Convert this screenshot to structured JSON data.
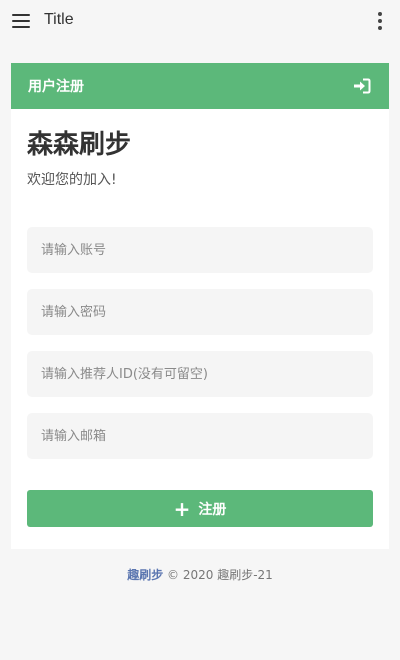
{
  "appbar": {
    "title": "Title",
    "menu_icon": "hamburger-menu-icon",
    "more_icon": "more-vert-icon"
  },
  "card": {
    "header_title": "用户注册",
    "header_icon": "sign-in-icon",
    "brand": "森森刷步",
    "welcome": "欢迎您的加入!"
  },
  "form": {
    "account_placeholder": "请输入账号",
    "password_placeholder": "请输入密码",
    "referrer_placeholder": "请输入推荐人ID(没有可留空)",
    "email_placeholder": "请输入邮箱",
    "submit_label": "注册",
    "submit_icon": "plus-icon"
  },
  "footer": {
    "link": "趣刷步",
    "copyright": "© 2020 趣刷步-21"
  },
  "colors": {
    "accent": "#5cb87a",
    "link": "#5b76b0",
    "background": "#f6f6f6"
  }
}
